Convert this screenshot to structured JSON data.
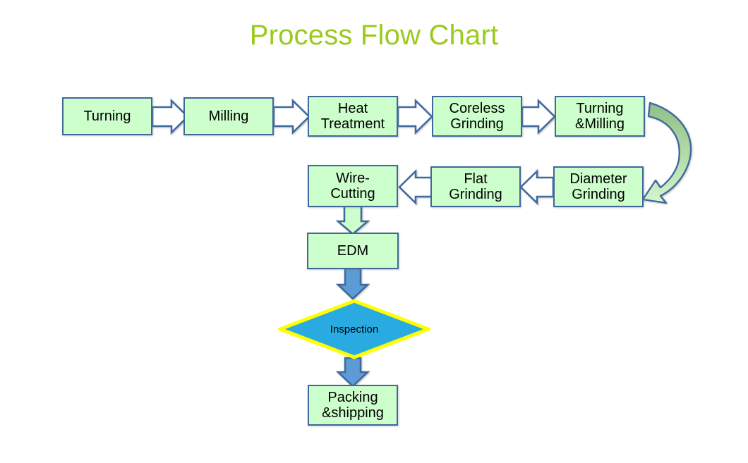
{
  "title": "Process Flow Chart",
  "theme": {
    "title_color": "#9ACA1E",
    "box_fill": "#CCFFCC",
    "box_border": "#41689B",
    "arrow_outline": "#3F6A9E",
    "arrow_fill_white": "#FFFFFF",
    "curved_arrow_fill": "#A9D5A0",
    "decision_fill": "#29ABE2",
    "decision_border": "#FFFF00",
    "blue_arrow_fill": "#5B9BD5",
    "background": "#FFFFFF"
  },
  "nodes": [
    {
      "id": "turning",
      "label": "Turning",
      "shape": "process",
      "row": 1
    },
    {
      "id": "milling",
      "label": "Milling",
      "shape": "process",
      "row": 1
    },
    {
      "id": "heat-treatment",
      "label": "Heat\nTreatment",
      "shape": "process",
      "row": 1
    },
    {
      "id": "coreless-grinding",
      "label": "Coreless\nGrinding",
      "shape": "process",
      "row": 1
    },
    {
      "id": "turning-milling",
      "label": "Turning\n&Milling",
      "shape": "process",
      "row": 1
    },
    {
      "id": "diameter-grinding",
      "label": "Diameter\nGrinding",
      "shape": "process",
      "row": 2
    },
    {
      "id": "flat-grinding",
      "label": "Flat\nGrinding",
      "shape": "process",
      "row": 2
    },
    {
      "id": "wire-cutting",
      "label": "Wire-\nCutting",
      "shape": "process",
      "row": 2
    },
    {
      "id": "edm",
      "label": "EDM",
      "shape": "process",
      "row": 3
    },
    {
      "id": "inspection",
      "label": "Inspection",
      "shape": "decision",
      "row": 4
    },
    {
      "id": "packing-shipping",
      "label": "Packing\n&shipping",
      "shape": "process",
      "row": 5
    }
  ],
  "connectors": [
    {
      "id": "turning-to-milling",
      "from": "turning",
      "to": "milling",
      "style": "block-arrow-outline",
      "direction": "right"
    },
    {
      "id": "milling-to-heat-treatment",
      "from": "milling",
      "to": "heat-treatment",
      "style": "block-arrow-outline",
      "direction": "right"
    },
    {
      "id": "heat-treatment-to-coreless-grinding",
      "from": "heat-treatment",
      "to": "coreless-grinding",
      "style": "block-arrow-outline",
      "direction": "right"
    },
    {
      "id": "coreless-grinding-to-turning-milling",
      "from": "coreless-grinding",
      "to": "turning-milling",
      "style": "block-arrow-outline",
      "direction": "right"
    },
    {
      "id": "turning-milling-to-diameter-grinding",
      "from": "turning-milling",
      "to": "diameter-grinding",
      "style": "curved-arrow-green",
      "direction": "down-left"
    },
    {
      "id": "diameter-grinding-to-flat-grinding",
      "from": "diameter-grinding",
      "to": "flat-grinding",
      "style": "block-arrow-outline",
      "direction": "left"
    },
    {
      "id": "flat-grinding-to-wire-cutting",
      "from": "flat-grinding",
      "to": "wire-cutting",
      "style": "block-arrow-outline",
      "direction": "left"
    },
    {
      "id": "wire-cutting-to-edm",
      "from": "wire-cutting",
      "to": "edm",
      "style": "block-arrow-green",
      "direction": "down"
    },
    {
      "id": "edm-to-inspection",
      "from": "edm",
      "to": "inspection",
      "style": "block-arrow-blue",
      "direction": "down"
    },
    {
      "id": "inspection-to-packing-shipping",
      "from": "inspection",
      "to": "packing-shipping",
      "style": "block-arrow-blue",
      "direction": "down"
    }
  ]
}
